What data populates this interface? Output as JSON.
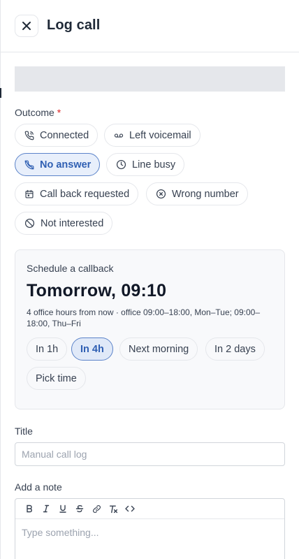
{
  "header": {
    "title": "Log call"
  },
  "outcome": {
    "label": "Outcome",
    "required_mark": "*",
    "options": [
      {
        "label": "Connected",
        "icon": "phone-icon"
      },
      {
        "label": "Left voicemail",
        "icon": "voicemail-icon"
      },
      {
        "label": "No answer",
        "icon": "phone-missed-icon",
        "selected": true
      },
      {
        "label": "Line busy",
        "icon": "clock-icon"
      },
      {
        "label": "Call back requested",
        "icon": "calendar-icon"
      },
      {
        "label": "Wrong number",
        "icon": "x-circle-icon"
      },
      {
        "label": "Not interested",
        "icon": "ban-icon"
      }
    ]
  },
  "callback": {
    "label": "Schedule a callback",
    "time": "Tomorrow, 09:10",
    "subtitle": "4 office hours from now · office 09:00–18:00, Mon–Tue; 09:00–18:00, Thu–Fri",
    "options": [
      {
        "label": "In 1h"
      },
      {
        "label": "In 4h",
        "selected": true
      },
      {
        "label": "Next morning"
      },
      {
        "label": "In 2 days"
      },
      {
        "label": "Pick time"
      }
    ]
  },
  "title_field": {
    "label": "Title",
    "placeholder": "Manual call log"
  },
  "note": {
    "label": "Add a note",
    "placeholder": "Type something...",
    "toolbar": [
      "B",
      "I",
      "U",
      "S",
      "link",
      "clear-format",
      "code"
    ]
  },
  "colors": {
    "accent": "#2f5fb3",
    "accent_bg": "#e8effb",
    "required": "#dc2626",
    "border": "#e5e7eb"
  }
}
